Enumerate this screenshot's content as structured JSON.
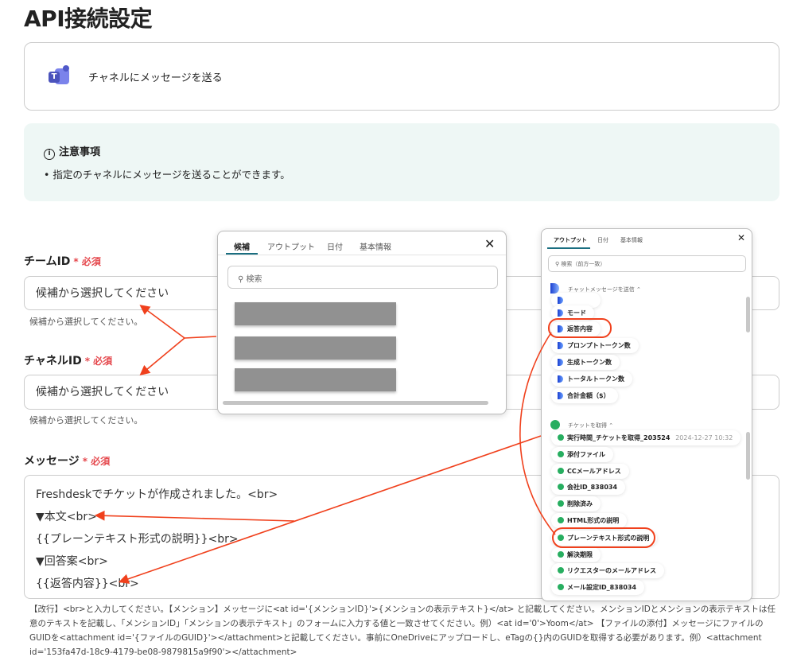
{
  "page_title": "API接続設定",
  "action_card": {
    "label": "チャネルにメッセージを送る",
    "icon": "microsoft-teams-icon"
  },
  "notice": {
    "title": "注意事項",
    "items": [
      "指定のチャネルにメッセージを送ることができます。"
    ]
  },
  "fields": {
    "team_id": {
      "label": "チームID",
      "required": "必須",
      "placeholder": "候補から選択してください",
      "help": "候補から選択してください。"
    },
    "channel_id": {
      "label": "チャネルID",
      "required": "必須",
      "placeholder": "候補から選択してください",
      "help": "候補から選択してください。"
    },
    "message": {
      "label": "メッセージ",
      "required": "必須",
      "lines": [
        "Freshdeskでチケットが作成されました。<br>",
        "▼本文<br>",
        "{{プレーンテキスト形式の説明}}<br>",
        "▼回答案<br>",
        "{{返答内容}}<br>"
      ],
      "help": "【改行】<br>と入力してください。【メンション】メッセージに<at id='{メンションID}'>{メンションの表示テキスト}</at> と記載してください。メンションIDとメンションの表示テキストは任意のテキストを記載し、「メンションID」「メンションの表示テキスト」のフォームに入力する値と一致させてください。例）<at id='0'>Yoom</at> 【ファイルの添付】メッセージにファイルのGUIDを<attachment id='{ファイルのGUID}'></attachment>と記載してください。事前にOneDriveにアップロードし、eTagの{}内のGUIDを取得する必要があります。例）<attachment id='153fa47d-18c9-4179-be08-9879815a9f90'></attachment>"
    }
  },
  "candidate_popup": {
    "tabs": [
      "候補",
      "アウトプット",
      "日付",
      "基本情報"
    ],
    "search_placeholder": "検索"
  },
  "output_popup": {
    "tabs": [
      "アウトプット",
      "日付",
      "基本情報"
    ],
    "search_placeholder": "検索（前方一致）",
    "sections": [
      {
        "title": "チャットメッセージを送信",
        "items": [
          "モード",
          "返答内容",
          "プロンプトトークン数",
          "生成トークン数",
          "トータルトークン数",
          "合計金額（$）"
        ]
      },
      {
        "title": "チケットを取得",
        "items": [
          "実行時間_チケットを取得_203524",
          "添付ファイル",
          "CCメールアドレス",
          "会社ID_838034",
          "削除済み",
          "HTML形式の説明",
          "プレーンテキスト形式の説明",
          "解決期限",
          "リクエスターのメールアドレス",
          "メール設定ID_838034"
        ],
        "first_item_meta": "2024-12-27 10:32"
      }
    ]
  },
  "colors": {
    "accent": "#1a6e80",
    "required": "#e5484d",
    "annotation": "#f0401c"
  }
}
